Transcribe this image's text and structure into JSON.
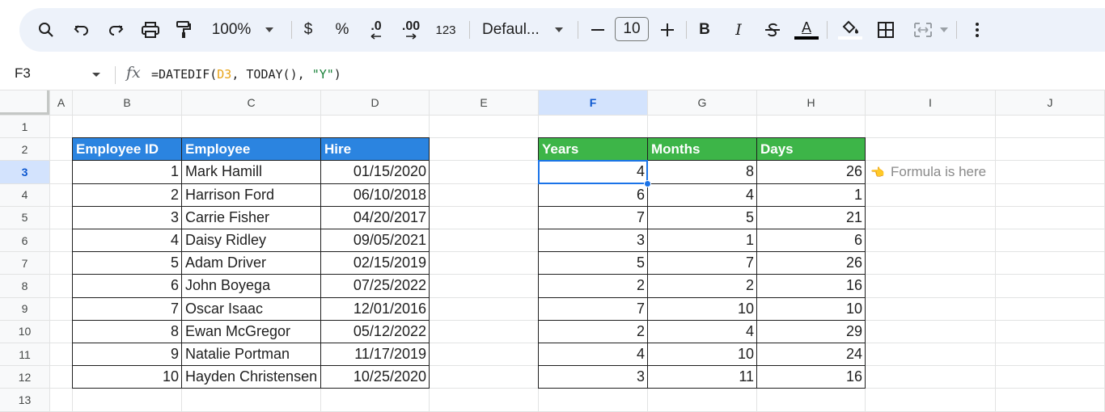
{
  "toolbar": {
    "zoom": "100%",
    "currency": "$",
    "percent": "%",
    "decrease_decimal": ".0",
    "increase_decimal": ".00",
    "number_format": "123",
    "font_name": "Defaul...",
    "font_size": "10",
    "bold": "B",
    "italic": "I",
    "text_color_letter": "A",
    "text_color": "#000000",
    "accent": "#edf2fa"
  },
  "formula_bar": {
    "name_box": "F3",
    "fx": "fx",
    "formula_prefix": "=DATEDIF(",
    "formula_ref": "D3",
    "formula_mid": ", TODAY(), ",
    "formula_str": "\"Y\"",
    "formula_suffix": ")"
  },
  "sheet": {
    "columns": [
      "A",
      "B",
      "C",
      "D",
      "E",
      "F",
      "G",
      "H",
      "I",
      "J"
    ],
    "rows": [
      "1",
      "2",
      "3",
      "4",
      "5",
      "6",
      "7",
      "8",
      "9",
      "10",
      "11",
      "12",
      "13"
    ],
    "selected_cell": "F3",
    "employee_table": {
      "headers": [
        "Employee ID",
        "Employee",
        "Hire"
      ],
      "rows": [
        [
          "1",
          "Mark Hamill",
          "01/15/2020"
        ],
        [
          "2",
          "Harrison Ford",
          "06/10/2018"
        ],
        [
          "3",
          "Carrie Fisher",
          "04/20/2017"
        ],
        [
          "4",
          "Daisy Ridley",
          "09/05/2021"
        ],
        [
          "5",
          "Adam Driver",
          "02/15/2019"
        ],
        [
          "6",
          "John Boyega",
          "07/25/2022"
        ],
        [
          "7",
          "Oscar Isaac",
          "12/01/2016"
        ],
        [
          "8",
          "Ewan McGregor",
          "05/12/2022"
        ],
        [
          "9",
          "Natalie Portman",
          "11/17/2019"
        ],
        [
          "10",
          "Hayden Christensen",
          "10/25/2020"
        ]
      ]
    },
    "duration_table": {
      "headers": [
        "Years",
        "Months",
        "Days"
      ],
      "rows": [
        [
          "4",
          "8",
          "26"
        ],
        [
          "6",
          "4",
          "1"
        ],
        [
          "7",
          "5",
          "21"
        ],
        [
          "3",
          "1",
          "6"
        ],
        [
          "5",
          "7",
          "26"
        ],
        [
          "2",
          "2",
          "16"
        ],
        [
          "7",
          "10",
          "10"
        ],
        [
          "2",
          "4",
          "29"
        ],
        [
          "4",
          "10",
          "24"
        ],
        [
          "3",
          "11",
          "16"
        ]
      ]
    },
    "note_icon": "👈",
    "note": "Formula is here",
    "colors": {
      "blue_header": "#2b84e0",
      "green_header": "#3db548",
      "selection": "#1a73e8"
    }
  }
}
